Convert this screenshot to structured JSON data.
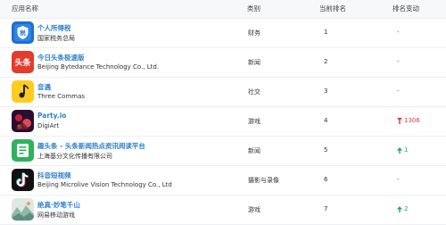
{
  "table": {
    "headers": {
      "app": "应用名称",
      "category": "类别",
      "rank": "当前排名",
      "change": "排名变动"
    },
    "rows": [
      {
        "name": "个人所得税",
        "company": "国家税务总局",
        "category": "财务",
        "rank": "1",
        "change": "-",
        "direction": "none",
        "icon": "tax-shield-icon",
        "icon_color": "#1f6fd1"
      },
      {
        "name": "今日头条极速版",
        "company": "Beijing Bytedance Technology Co., Ltd.",
        "category": "新闻",
        "rank": "2",
        "change": "-",
        "direction": "none",
        "icon": "toutiao-logo-icon",
        "icon_color": "#e53b2c"
      },
      {
        "name": "音遇",
        "company": "Three Commas",
        "category": "社交",
        "rank": "3",
        "change": "-",
        "direction": "none",
        "icon": "music-note-icon",
        "icon_color": "#ffcc1f"
      },
      {
        "name": "Party.io",
        "company": "DigiArt",
        "category": "游戏",
        "rank": "4",
        "change": "1306",
        "direction": "down",
        "icon": "party-io-icon",
        "icon_color": "#c4213a"
      },
      {
        "name": "趣头条 - 头条新闻热点资讯阅读平台",
        "company": "上海基分文化传播有限公司",
        "category": "新闻",
        "rank": "5",
        "change": "1",
        "direction": "up",
        "icon": "qutoutiao-icon",
        "icon_color": "#2fb25a"
      },
      {
        "name": "抖音短视频",
        "company": "Beijing Microlive Vision Technology Co., Ltd",
        "category": "摄影与录像",
        "rank": "6",
        "change": "-",
        "direction": "none",
        "icon": "douyin-icon",
        "icon_color": "#111111"
      },
      {
        "name": "绝真·妙笔千山",
        "company": "网易移动游戏",
        "category": "游戏",
        "rank": "7",
        "change": "2",
        "direction": "up",
        "icon": "landscape-painting-icon",
        "icon_color": "#8fb8a8"
      }
    ]
  }
}
